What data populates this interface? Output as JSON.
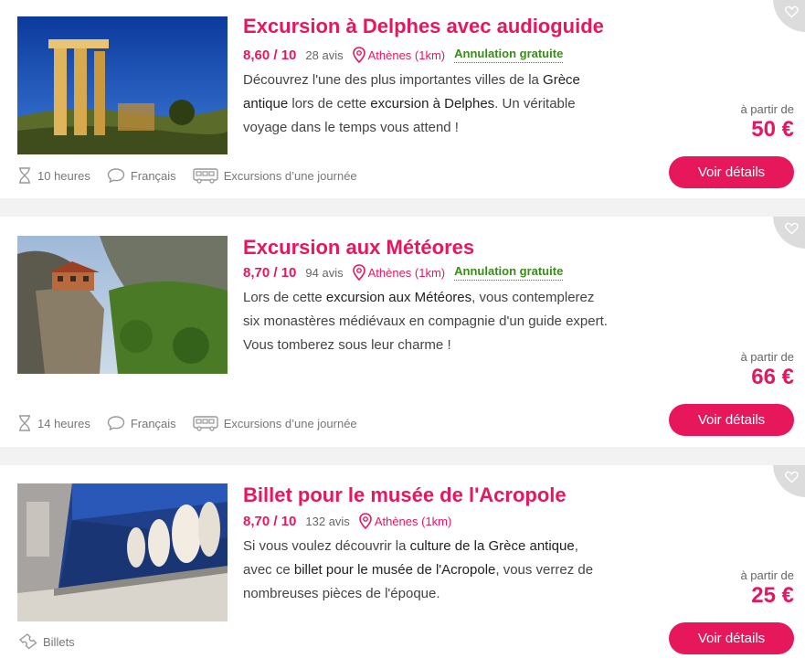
{
  "colors": {
    "accent": "#e6185b",
    "success": "#3a8a1c",
    "separator": "#f2f2f2"
  },
  "cards": [
    {
      "title": "Excursion à Delphes avec audioguide",
      "score": "8,60 / 10",
      "reviews": "28 avis",
      "location": "Athènes (1km)",
      "cancellation": "Annulation gratuite",
      "desc_parts": [
        "Découvrez l'une des plus importantes villes de la ",
        "Grèce antique",
        " lors de cette ",
        "excursion à Delphes",
        ". Un véritable voyage dans le temps vous attend !"
      ],
      "price_label": "à partir de",
      "price": "50 €",
      "button": "Voir détails",
      "features": [
        {
          "icon": "hourglass-icon",
          "label": "10 heures"
        },
        {
          "icon": "speech-bubble-icon",
          "label": "Français"
        },
        {
          "icon": "bus-icon",
          "label": "Excursions d’une journée"
        }
      ]
    },
    {
      "title": "Excursion aux Météores",
      "score": "8,70 / 10",
      "reviews": "94 avis",
      "location": "Athènes (1km)",
      "cancellation": "Annulation gratuite",
      "desc_parts": [
        "Lors de cette ",
        "excursion aux Météores",
        ", vous contemplerez six monastères médiévaux en compagnie d'un guide expert.  Vous tomberez sous leur charme !",
        "",
        ""
      ],
      "price_label": "à partir de",
      "price": "66 €",
      "button": "Voir détails",
      "features": [
        {
          "icon": "hourglass-icon",
          "label": "14 heures"
        },
        {
          "icon": "speech-bubble-icon",
          "label": "Français"
        },
        {
          "icon": "bus-icon",
          "label": "Excursions d’une journée"
        }
      ]
    },
    {
      "title": "Billet pour le musée de l'Acropole",
      "score": "8,70 / 10",
      "reviews": "132 avis",
      "location": "Athènes (1km)",
      "cancellation": "",
      "desc_parts": [
        "Si vous voulez découvrir la ",
        "culture de la Grèce antique",
        ", avec ce ",
        "billet pour le musée de l'Acropole",
        ", vous verrez de nombreuses pièces de l'époque."
      ],
      "price_label": "à partir de",
      "price": "25 €",
      "button": "Voir détails",
      "features": [
        {
          "icon": "ticket-icon",
          "label": "Billets"
        }
      ]
    }
  ]
}
